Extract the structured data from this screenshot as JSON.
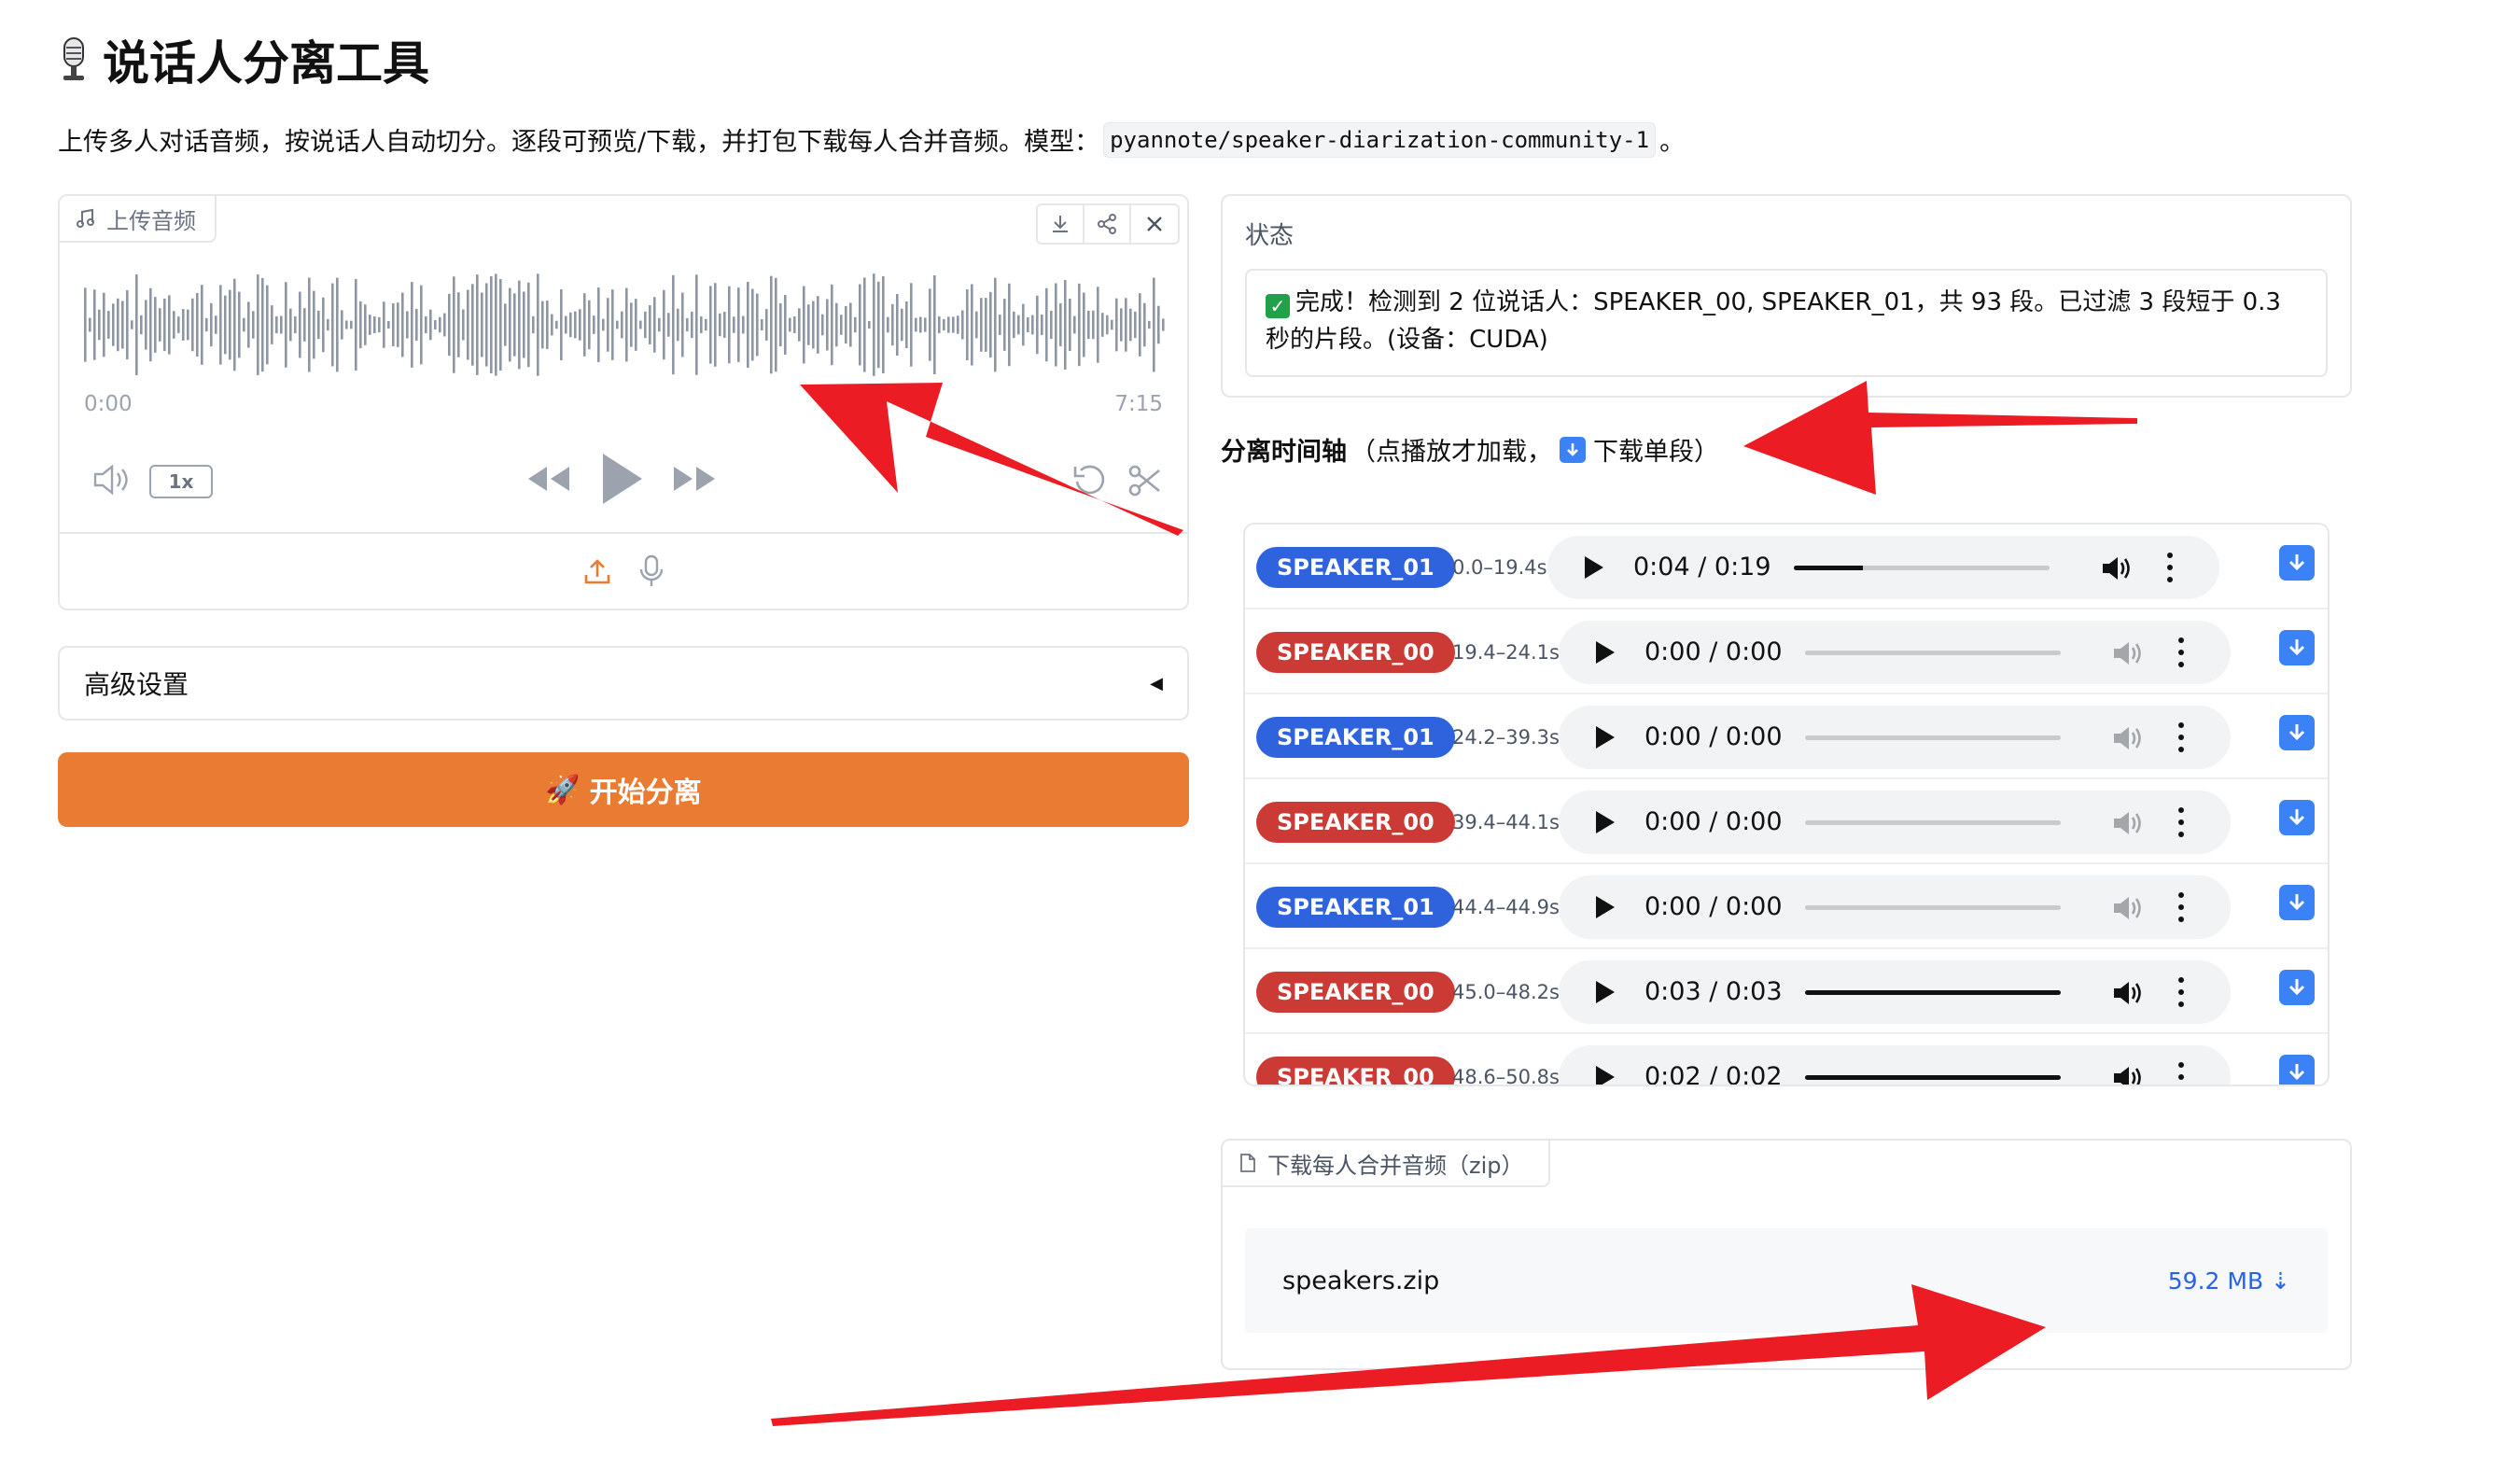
{
  "header": {
    "title": "说话人分离工具",
    "description_prefix": "上传多人对话音频，按说话人自动切分。逐段可预览/下载，并打包下载每人合并音频。模型：",
    "model_code": "pyannote/speaker-diarization-community-1",
    "description_suffix": "。"
  },
  "upload": {
    "label": "上传音频",
    "time_start": "0:00",
    "time_end": "7:15",
    "rate": "1x"
  },
  "advanced": {
    "label": "高级设置",
    "caret": "◀"
  },
  "start_button": {
    "emoji": "🚀",
    "label": "开始分离"
  },
  "status": {
    "label": "状态",
    "message": "完成！检测到 2 位说话人：SPEAKER_00, SPEAKER_01，共 93 段。已过滤 3 段短于 0.3 秒的片段。(设备：CUDA)"
  },
  "timeline": {
    "title_bold": "分离时间轴",
    "title_rest_a": "（点播放才加载，",
    "title_rest_b": "下载单段）",
    "segments": [
      {
        "speaker": "SPEAKER_01",
        "range": "0.0–19.4s",
        "time": "0:04 / 0:19",
        "progress": 0.27,
        "active": true
      },
      {
        "speaker": "SPEAKER_00",
        "range": "19.4–24.1s",
        "time": "0:00 / 0:00",
        "progress": 0,
        "active": false
      },
      {
        "speaker": "SPEAKER_01",
        "range": "24.2–39.3s",
        "time": "0:00 / 0:00",
        "progress": 0,
        "active": false
      },
      {
        "speaker": "SPEAKER_00",
        "range": "39.4–44.1s",
        "time": "0:00 / 0:00",
        "progress": 0,
        "active": false
      },
      {
        "speaker": "SPEAKER_01",
        "range": "44.4–44.9s",
        "time": "0:00 / 0:00",
        "progress": 0,
        "active": false
      },
      {
        "speaker": "SPEAKER_00",
        "range": "45.0–48.2s",
        "time": "0:03 / 0:03",
        "progress": 1,
        "active": true
      },
      {
        "speaker": "SPEAKER_00",
        "range": "48.6–50.8s",
        "time": "0:02 / 0:02",
        "progress": 1,
        "active": true
      }
    ]
  },
  "download": {
    "label": "下载每人合并音频（zip）",
    "file_name": "speakers.zip",
    "file_size": "59.2 MB ⇣"
  },
  "colors": {
    "accent": "#ea7b32",
    "speaker_00": "#cc3a35",
    "speaker_01": "#2f62dd",
    "download": "#3b82f6",
    "annotation_arrow": "#ec1c24"
  }
}
